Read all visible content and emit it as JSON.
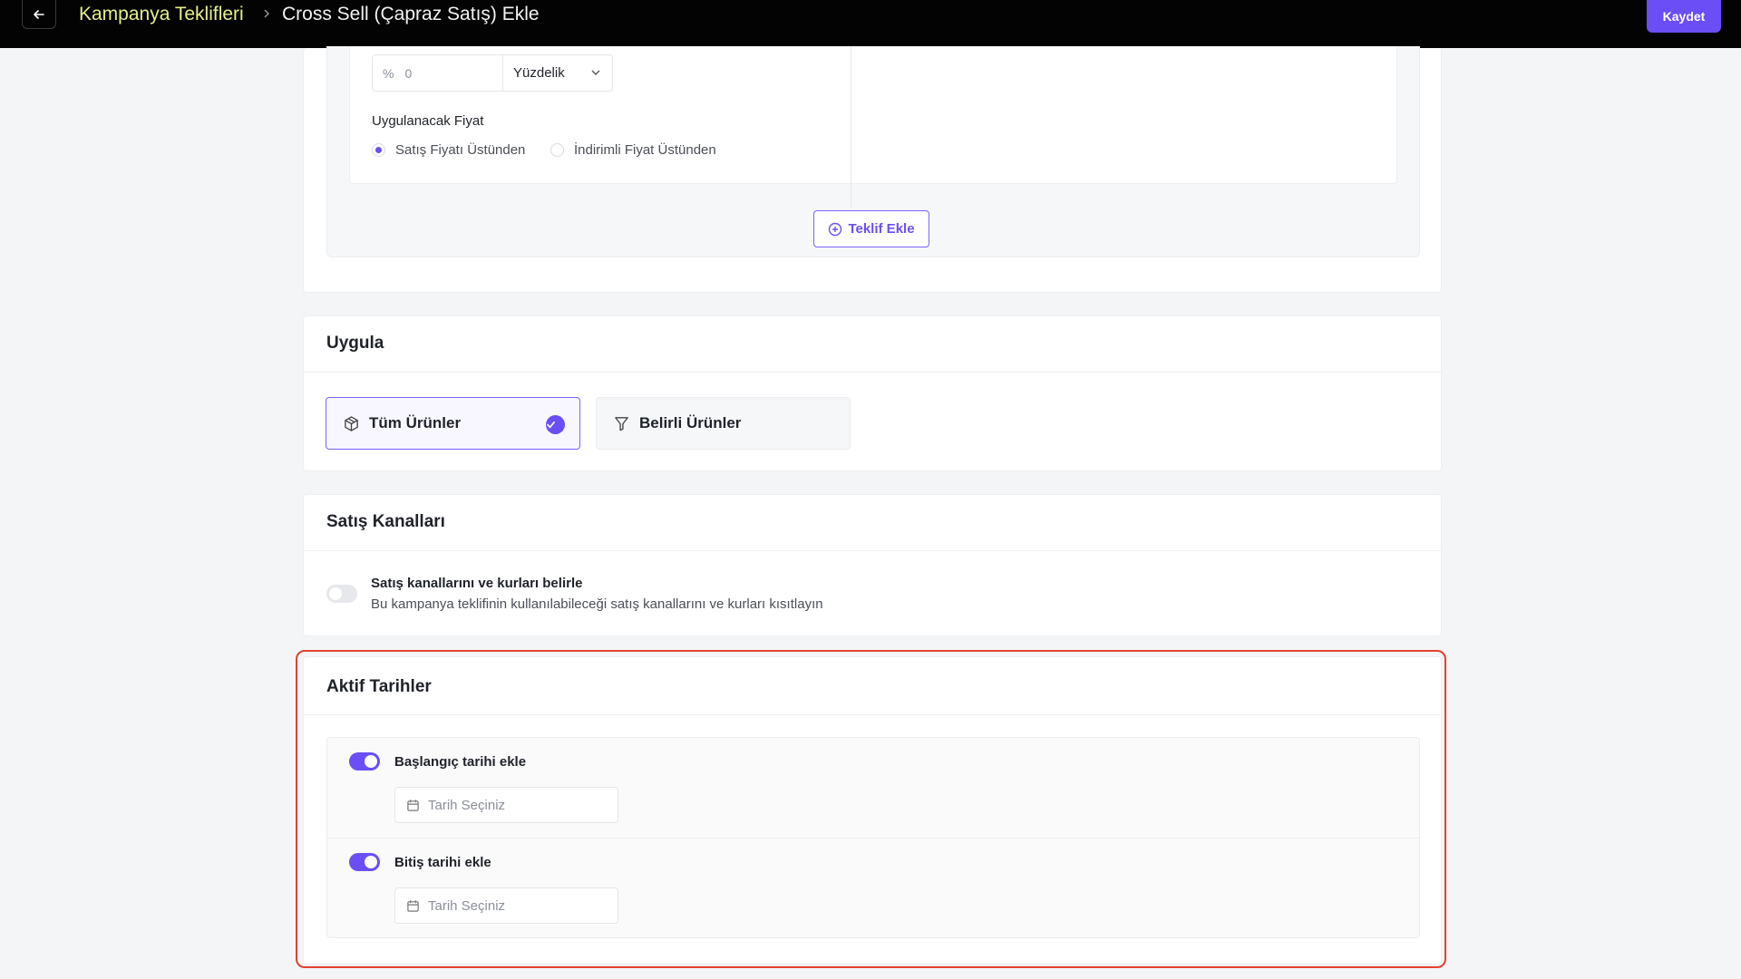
{
  "header": {
    "back_label": "←",
    "breadcrumb_parent": "Kampanya Teklifleri",
    "breadcrumb_separator": ">",
    "page_title": "Cross Sell (Çapraz Satış) Ekle",
    "save_label": "Kaydet"
  },
  "offer": {
    "percent_symbol": "%",
    "discount_value": "0",
    "discount_type": "Yüzdelik",
    "price_label": "Uygulanacak Fiyat",
    "price_options": [
      {
        "label": "Satış Fiyatı Üstünden",
        "selected": true
      },
      {
        "label": "İndirimli Fiyat Üstünden",
        "selected": false
      }
    ],
    "add_offer_label": "Teklif Ekle"
  },
  "apply": {
    "title": "Uygula",
    "options": [
      {
        "label": "Tüm Ürünler",
        "selected": true
      },
      {
        "label": "Belirli Ürünler",
        "selected": false
      }
    ]
  },
  "sales_channels": {
    "title": "Satış Kanalları",
    "toggle_title": "Satış kanallarını ve kurları belirle",
    "toggle_desc": "Bu kampanya teklifinin kullanılabileceği satış kanallarını ve kurları kısıtlayın",
    "enabled": false
  },
  "active_dates": {
    "title": "Aktif Tarihler",
    "start": {
      "label": "Başlangıç tarihi ekle",
      "enabled": true,
      "placeholder": "Tarih Seçiniz"
    },
    "end": {
      "label": "Bitiş tarihi ekle",
      "enabled": true,
      "placeholder": "Tarih Seçiniz"
    }
  },
  "colors": {
    "accent": "#6b4ef6",
    "breadcrumb_link": "#e7ef8a",
    "highlight_border": "#e2412f",
    "topbar": "#030303"
  }
}
